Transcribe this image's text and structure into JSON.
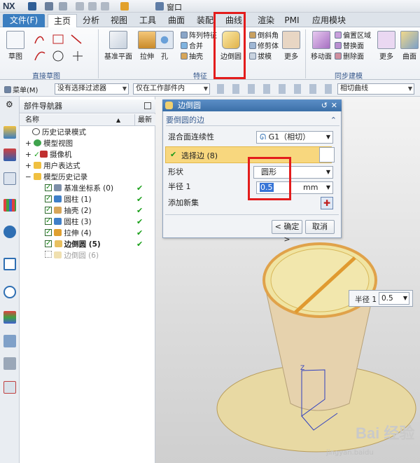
{
  "app": {
    "logo": "NX",
    "window_menu": "窗口"
  },
  "ribbon_tabs": [
    {
      "label": "文件(F)"
    },
    {
      "label": "主页"
    },
    {
      "label": "分析"
    },
    {
      "label": "视图"
    },
    {
      "label": "工具"
    },
    {
      "label": "曲面"
    },
    {
      "label": "装配"
    },
    {
      "label": "曲线"
    },
    {
      "label": "渲染"
    },
    {
      "label": "PMI"
    },
    {
      "label": "应用模块"
    }
  ],
  "ribbon": {
    "sketch": "草图",
    "group_direct_sketch": "直接草图",
    "datum_plane": "基准平面",
    "extrude": "拉伸",
    "hole": "孔",
    "pattern_feature": "阵列特征",
    "unite": "合并",
    "shell": "抽壳",
    "edge_blend": "边倒圆",
    "chamfer": "倒斜角",
    "trim_body": "修剪体",
    "draft": "拔模",
    "more_1": "更多",
    "group_feature": "特征",
    "move_face": "移动面",
    "offset_region": "偏置区域",
    "replace_face": "替换面",
    "delete_face": "删除面",
    "more_2": "更多",
    "group_sync": "同步建模",
    "surface": "曲面"
  },
  "filterbar": {
    "menu": "菜单(M)",
    "filter": "没有选择过滤器",
    "scope": "仅在工作部件内",
    "curve_rule": "相切曲线"
  },
  "navigator": {
    "title": "部件导航器",
    "col_name": "名称",
    "col_latest": "最新",
    "items": [
      {
        "label": "历史记录模式"
      },
      {
        "label": "模型视图"
      },
      {
        "label": "摄像机"
      },
      {
        "label": "用户表达式"
      },
      {
        "label": "模型历史记录"
      },
      {
        "label": "基准坐标系 (0)"
      },
      {
        "label": "圆柱 (1)"
      },
      {
        "label": "抽壳 (2)"
      },
      {
        "label": "圆柱 (3)"
      },
      {
        "label": "拉伸 (4)"
      },
      {
        "label": "边倒圆 (5)"
      },
      {
        "label": "边倒圆 (6)"
      }
    ]
  },
  "dialog": {
    "title": "边倒圆",
    "section": "要倒圆的边",
    "continuity_label": "混合面连续性",
    "continuity_value": "G1（相切）",
    "select_edge": "选择边 (8)",
    "shape_label": "形状",
    "shape_value": "圆形",
    "radius_label": "半径 1",
    "radius_value": "0.5",
    "unit": "mm",
    "add_new_set": "添加新集",
    "ok": "< 确定 >",
    "cancel": "取消"
  },
  "viewport": {
    "radius_callout_label": "半径 1",
    "radius_callout_value": "0.5",
    "watermark": "Bai 经验",
    "watermark_url": "jingyan.baidu"
  },
  "colors": {
    "highlight_red": "#e31c1c",
    "selection_yellow": "#f8d77e",
    "title_blue": "#3b6fa8"
  }
}
